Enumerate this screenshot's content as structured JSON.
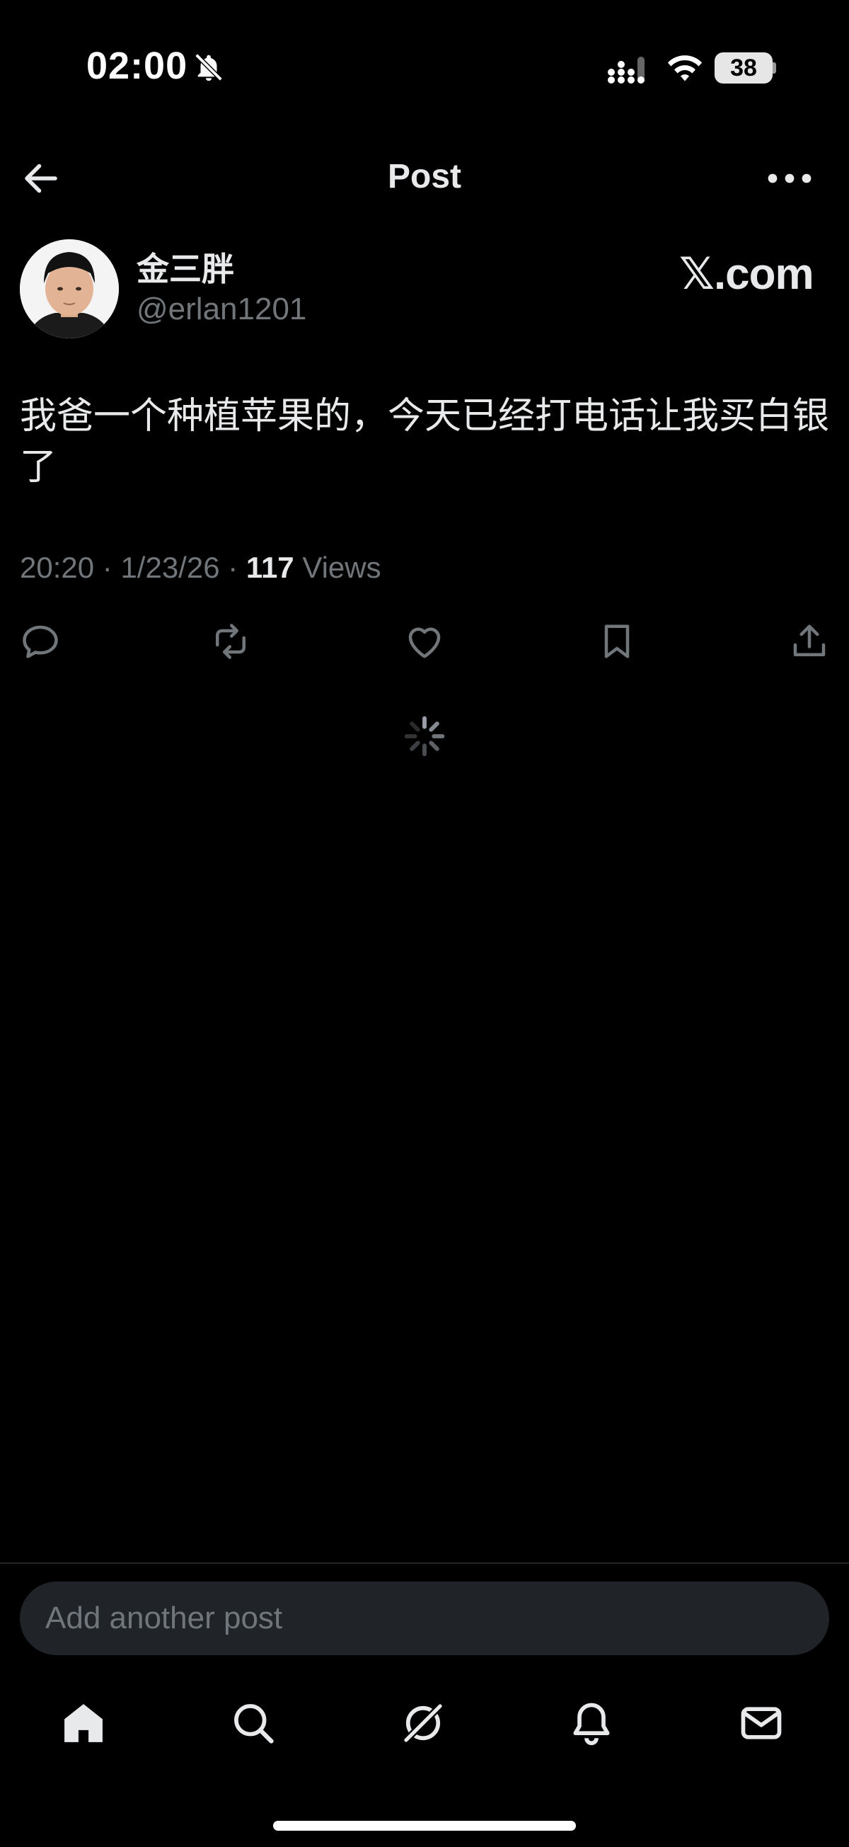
{
  "status_bar": {
    "time": "02:00",
    "battery": "38"
  },
  "header": {
    "title": "Post"
  },
  "post": {
    "author_name": "金三胖",
    "author_handle": "@erlan1201",
    "source_label": "𝕏.com",
    "text": "我爸一个种植苹果的，今天已经打电话让我买白银了",
    "time": "20:20",
    "date": "1/23/26",
    "views_count": "117",
    "views_label": "Views"
  },
  "composer": {
    "placeholder": "Add another post"
  },
  "icons": {
    "status": [
      "bell-off-icon",
      "signal-icon",
      "wifi-icon",
      "battery-icon"
    ],
    "header": [
      "back-arrow-icon",
      "more-icon"
    ],
    "actions": [
      "reply-icon",
      "repost-icon",
      "like-icon",
      "bookmark-icon",
      "share-icon"
    ],
    "nav": [
      "home-icon",
      "search-icon",
      "grok-icon",
      "notifications-icon",
      "messages-icon"
    ]
  },
  "colors": {
    "background": "#000000",
    "text": "#e7e9ea",
    "secondary_text": "#71767b",
    "composer_bg": "#202327"
  }
}
